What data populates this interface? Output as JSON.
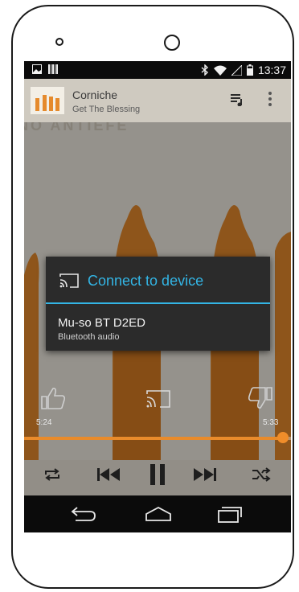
{
  "status": {
    "time": "13:37"
  },
  "now_playing": {
    "song": "Corniche",
    "artist": "Get The Blessing"
  },
  "album_art_text": "NO ANTIEFE",
  "player": {
    "elapsed": "5:24",
    "total": "5:33",
    "progress": 0.97
  },
  "dialog": {
    "title": "Connect to device",
    "device_name": "Mu-so BT D2ED",
    "device_type": "Bluetooth audio"
  },
  "colors": {
    "accent": "#33b5e5",
    "seek": "#e98b2b",
    "dialog_bg": "#2b2b2b"
  },
  "icons": [
    "image-icon",
    "barcode-icon",
    "bluetooth-icon",
    "wifi-icon",
    "signal-icon",
    "battery-icon",
    "queue-icon",
    "more-icon",
    "thumbs-up-icon",
    "cast-icon",
    "thumbs-down-icon",
    "repeat-icon",
    "previous-icon",
    "pause-icon",
    "next-icon",
    "shuffle-icon",
    "back-icon",
    "home-icon",
    "recents-icon"
  ]
}
